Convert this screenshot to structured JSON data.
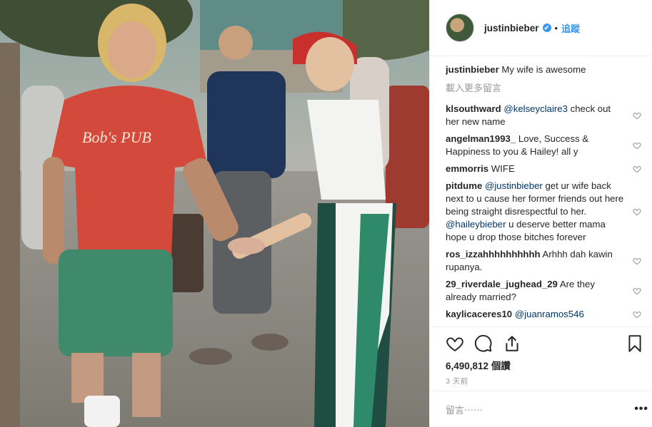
{
  "header": {
    "username": "justinbieber",
    "verified_mark": "✔",
    "separator": "•",
    "follow_label": "追蹤"
  },
  "caption": {
    "username": "justinbieber",
    "text": "My wife is awesome"
  },
  "load_more_label": "載入更多留言",
  "comments": [
    {
      "username": "klsouthward",
      "parts": [
        {
          "mention": "@kelseyclaire3"
        },
        {
          "text": " check out her new name"
        }
      ]
    },
    {
      "username": "angelman1993_",
      "parts": [
        {
          "text": "Love, Success & Happiness to you & Hailey! all y"
        }
      ]
    },
    {
      "username": "emmorris",
      "parts": [
        {
          "text": "WIFE"
        }
      ]
    },
    {
      "username": "pitdume",
      "parts": [
        {
          "mention": "@justinbieber"
        },
        {
          "text": " get ur wife back next to u cause her former friends out here being straight disrespectful to her. "
        },
        {
          "mention": "@haileybieber"
        },
        {
          "text": " u deserve better mama hope u drop those bitches forever"
        }
      ]
    },
    {
      "username": "ros_izzahhhhhhhhhh",
      "parts": [
        {
          "text": "Arhhh dah kawin rupanya."
        }
      ]
    },
    {
      "username": "29_riverdale_jughead_29",
      "parts": [
        {
          "text": "Are they already married?"
        }
      ]
    },
    {
      "username": "kaylicaceres10",
      "parts": [
        {
          "mention": "@juanramos546"
        }
      ]
    }
  ],
  "likes": {
    "count": "6,490,812",
    "label": "個讚"
  },
  "timestamp": "3 天前",
  "add_comment_placeholder": "留言⋯⋯",
  "more_label": "•••",
  "icons": {
    "like": "heart-outline-icon",
    "comment": "speech-bubble-icon",
    "share": "share-arrow-icon",
    "save": "bookmark-icon",
    "comment_like": "heart-outline-icon",
    "verified": "verified-badge-icon",
    "more": "more-options-icon"
  },
  "colors": {
    "link": "#3897f0",
    "mention": "#003569",
    "muted": "#999999",
    "text": "#262626",
    "border": "#efefef"
  }
}
